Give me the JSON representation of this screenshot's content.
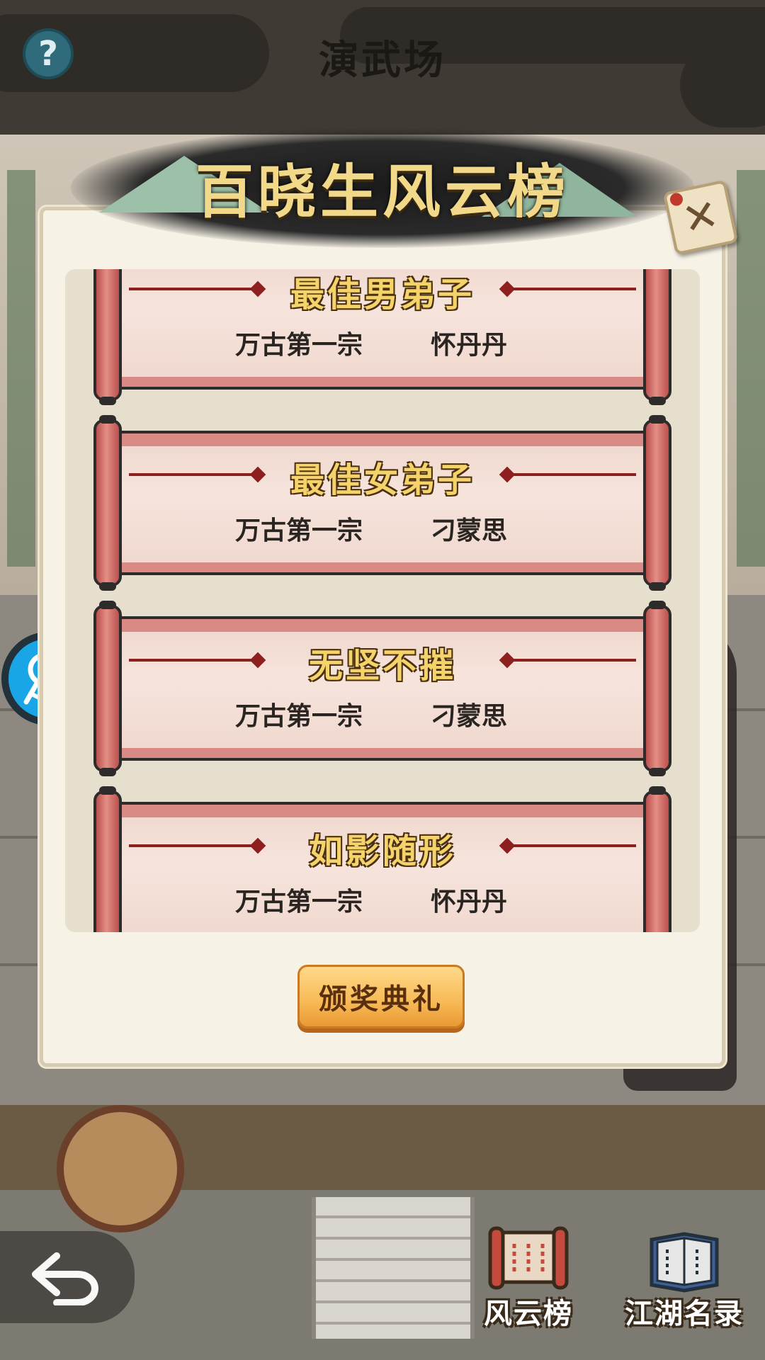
{
  "header": {
    "title": "演武场"
  },
  "modal": {
    "banner_title": "百晓生风云榜",
    "awards": [
      {
        "title": "最佳男弟子",
        "sect": "万古第一宗",
        "winner": "怀丹丹"
      },
      {
        "title": "最佳女弟子",
        "sect": "万古第一宗",
        "winner": "刁蒙思"
      },
      {
        "title": "无坚不摧",
        "sect": "万古第一宗",
        "winner": "刁蒙思"
      },
      {
        "title": "如影随形",
        "sect": "万古第一宗",
        "winner": "怀丹丹"
      }
    ],
    "ceremony_button": "颁奖典礼"
  },
  "bottom_nav": {
    "items": [
      {
        "label": "风云榜",
        "icon": "scroll-icon"
      },
      {
        "label": "江湖名录",
        "icon": "book-icon"
      }
    ]
  },
  "colors": {
    "banner_text": "#f2d98a",
    "award_title": "#f3d36a",
    "ceremony_button": "#f7b955",
    "key_button": "#1aa6e6"
  }
}
